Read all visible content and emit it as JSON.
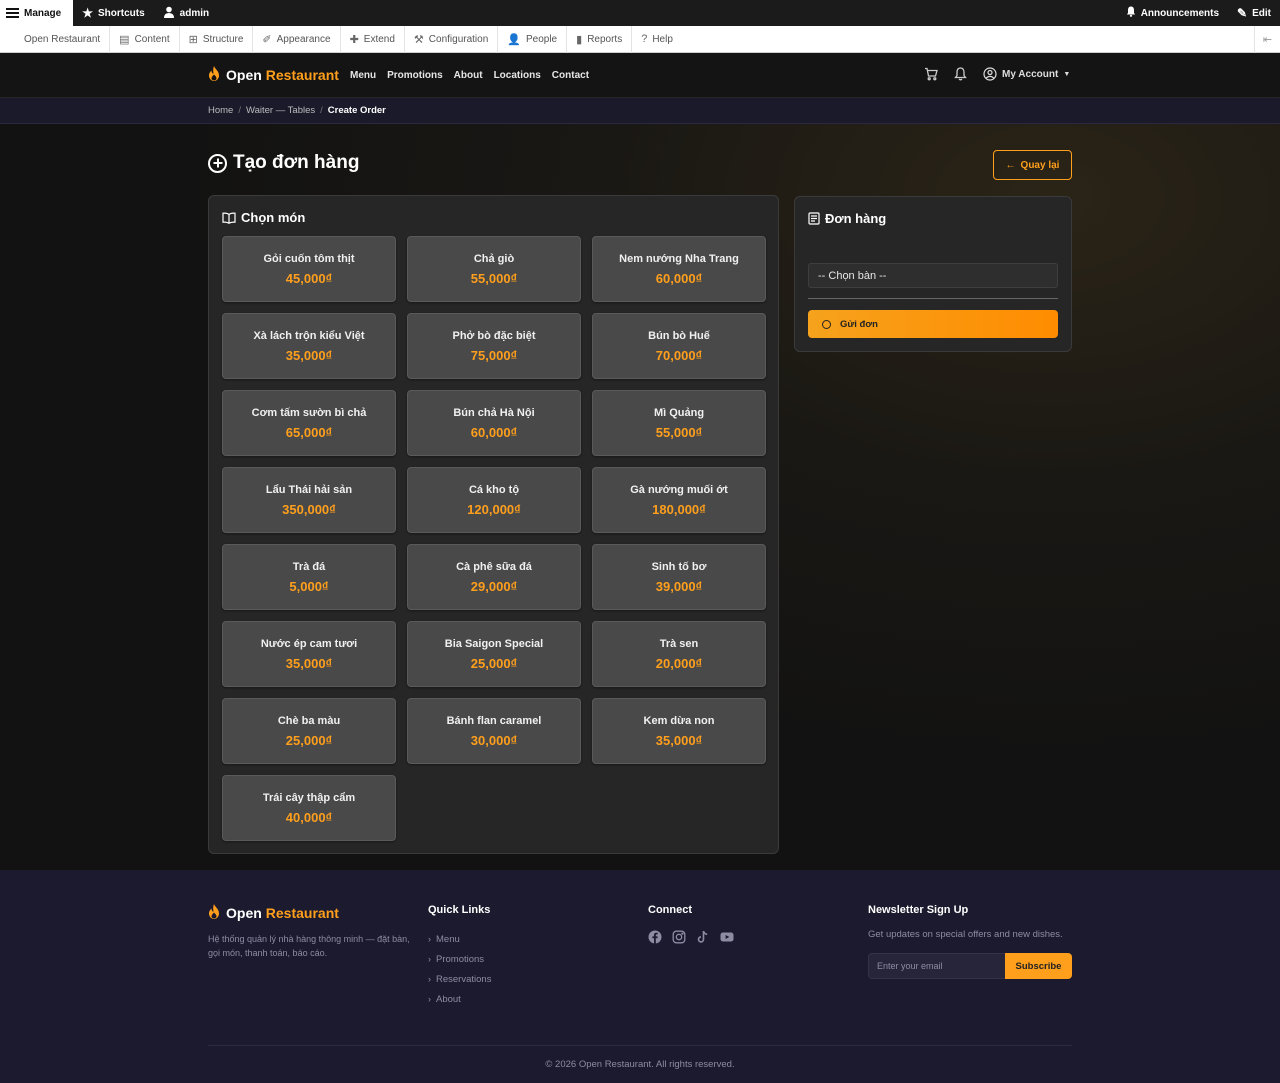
{
  "admin_toolbar": {
    "manage": "Manage",
    "shortcuts": "Shortcuts",
    "user": "admin",
    "announcements": "Announcements",
    "edit": "Edit"
  },
  "admin_menu": [
    "Open Restaurant",
    "Content",
    "Structure",
    "Appearance",
    "Extend",
    "Configuration",
    "People",
    "Reports",
    "Help"
  ],
  "site": {
    "logo_part1": "Open",
    "logo_part2": "Restaurant",
    "nav": [
      "Menu",
      "Promotions",
      "About",
      "Locations",
      "Contact"
    ],
    "account": "My Account"
  },
  "breadcrumb": [
    "Home",
    "Waiter — Tables",
    "Create Order"
  ],
  "page": {
    "title": "Tạo đơn hàng",
    "back_label": "Quay lại"
  },
  "menu_panel": {
    "heading": "Chọn món",
    "items": [
      {
        "name": "Gỏi cuốn tôm thịt",
        "price": "45,000₫"
      },
      {
        "name": "Chả giò",
        "price": "55,000₫"
      },
      {
        "name": "Nem nướng Nha Trang",
        "price": "60,000₫"
      },
      {
        "name": "Xà lách trộn kiểu Việt",
        "price": "35,000₫"
      },
      {
        "name": "Phở bò đặc biệt",
        "price": "75,000₫"
      },
      {
        "name": "Bún bò Huế",
        "price": "70,000₫"
      },
      {
        "name": "Cơm tấm sườn bì chả",
        "price": "65,000₫"
      },
      {
        "name": "Bún chả Hà Nội",
        "price": "60,000₫"
      },
      {
        "name": "Mì Quảng",
        "price": "55,000₫"
      },
      {
        "name": "Lẩu Thái hải sản",
        "price": "350,000₫"
      },
      {
        "name": "Cá kho tộ",
        "price": "120,000₫"
      },
      {
        "name": "Gà nướng muối ớt",
        "price": "180,000₫"
      },
      {
        "name": "Trà đá",
        "price": "5,000₫"
      },
      {
        "name": "Cà phê sữa đá",
        "price": "29,000₫"
      },
      {
        "name": "Sinh tố bơ",
        "price": "39,000₫"
      },
      {
        "name": "Nước ép cam tươi",
        "price": "35,000₫"
      },
      {
        "name": "Bia Saigon Special",
        "price": "25,000₫"
      },
      {
        "name": "Trà sen",
        "price": "20,000₫"
      },
      {
        "name": "Chè ba màu",
        "price": "25,000₫"
      },
      {
        "name": "Bánh flan caramel",
        "price": "30,000₫"
      },
      {
        "name": "Kem dừa non",
        "price": "35,000₫"
      },
      {
        "name": "Trái cây thập cẩm",
        "price": "40,000₫"
      }
    ]
  },
  "order_panel": {
    "heading": "Đơn hàng",
    "table_select": "-- Chọn bàn --",
    "submit_label": "Gửi đơn"
  },
  "footer": {
    "logo_part1": "Open",
    "logo_part2": "Restaurant",
    "description": "Hệ thống quản lý nhà hàng thông minh — đặt bàn, gọi món, thanh toán, báo cáo.",
    "quick_links_heading": "Quick Links",
    "quick_links": [
      "Menu",
      "Promotions",
      "Reservations",
      "About"
    ],
    "connect_heading": "Connect",
    "social_icons": [
      "facebook-icon",
      "instagram-icon",
      "tiktok-icon",
      "youtube-icon"
    ],
    "newsletter_heading": "Newsletter Sign Up",
    "newsletter_text": "Get updates on special offers and new dishes.",
    "email_placeholder": "Enter your email",
    "subscribe_label": "Subscribe",
    "copyright": "© 2026 Open Restaurant. All rights reserved."
  },
  "colors": {
    "accent": "#ff9f1c",
    "background": "#141414",
    "card": "#494949",
    "footer": "#1c1a2e"
  }
}
